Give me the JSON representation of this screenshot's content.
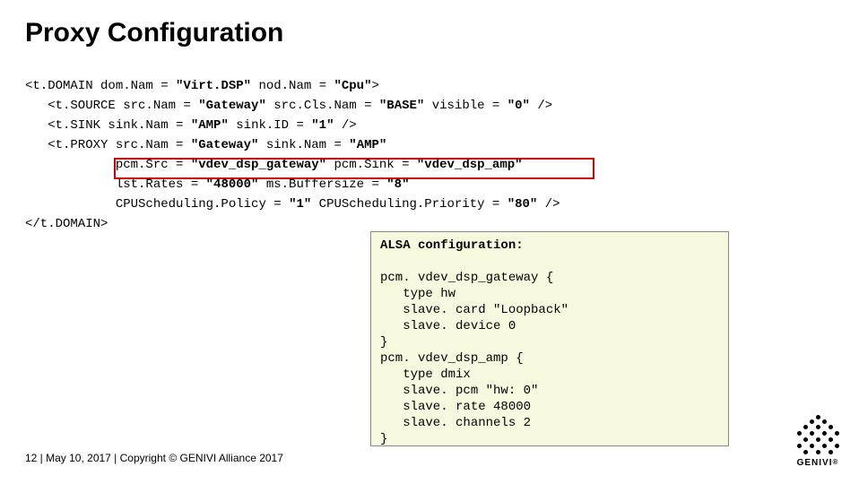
{
  "title": "Proxy Configuration",
  "code": {
    "l1a": "<t.DOMAIN dom.Nam = ",
    "l1b": "\"Virt.DSP\"",
    "l1c": " nod.Nam = ",
    "l1d": "\"Cpu\"",
    "l1e": ">",
    "l2a": "   <t.SOURCE src.Nam = ",
    "l2b": "\"Gateway\"",
    "l2c": " src.Cls.Nam = ",
    "l2d": "\"BASE\"",
    "l2e": " visible = ",
    "l2f": "\"0\"",
    "l2g": " />",
    "l3a": "   <t.SINK sink.Nam = ",
    "l3b": "\"AMP\"",
    "l3c": " sink.ID = ",
    "l3d": "\"1\"",
    "l3e": " />",
    "l4a": "   <t.PROXY src.Nam = ",
    "l4b": "\"Gateway\"",
    "l4c": " sink.Nam = ",
    "l4d": "\"AMP\"",
    "l5a": "            pcm.Src = ",
    "l5b": "\"vdev_dsp_gateway\"",
    "l5c": " pcm.Sink = ",
    "l5d": "\"vdev_dsp_amp\"",
    "l6a": "            lst.Rates = ",
    "l6b": "\"48000\"",
    "l6c": " ms.Buffersize = ",
    "l6d": "\"8\"",
    "l7a": "            CPUScheduling.Policy = ",
    "l7b": "\"1\"",
    "l7c": " CPUScheduling.Priority = ",
    "l7d": "\"80\"",
    "l7e": " />",
    "l8": "</t.DOMAIN>"
  },
  "alsa": {
    "head": "ALSA configuration:",
    "body": "pcm. vdev_dsp_gateway {\n   type hw\n   slave. card \"Loopback\"\n   slave. device 0\n}\npcm. vdev_dsp_amp {\n   type dmix\n   slave. pcm \"hw: 0\"\n   slave. rate 48000\n   slave. channels 2\n}"
  },
  "footer": "12   |   May 10, 2017   |   Copyright © GENIVI Alliance 2017",
  "logo": "GENIVI",
  "reg": "®"
}
